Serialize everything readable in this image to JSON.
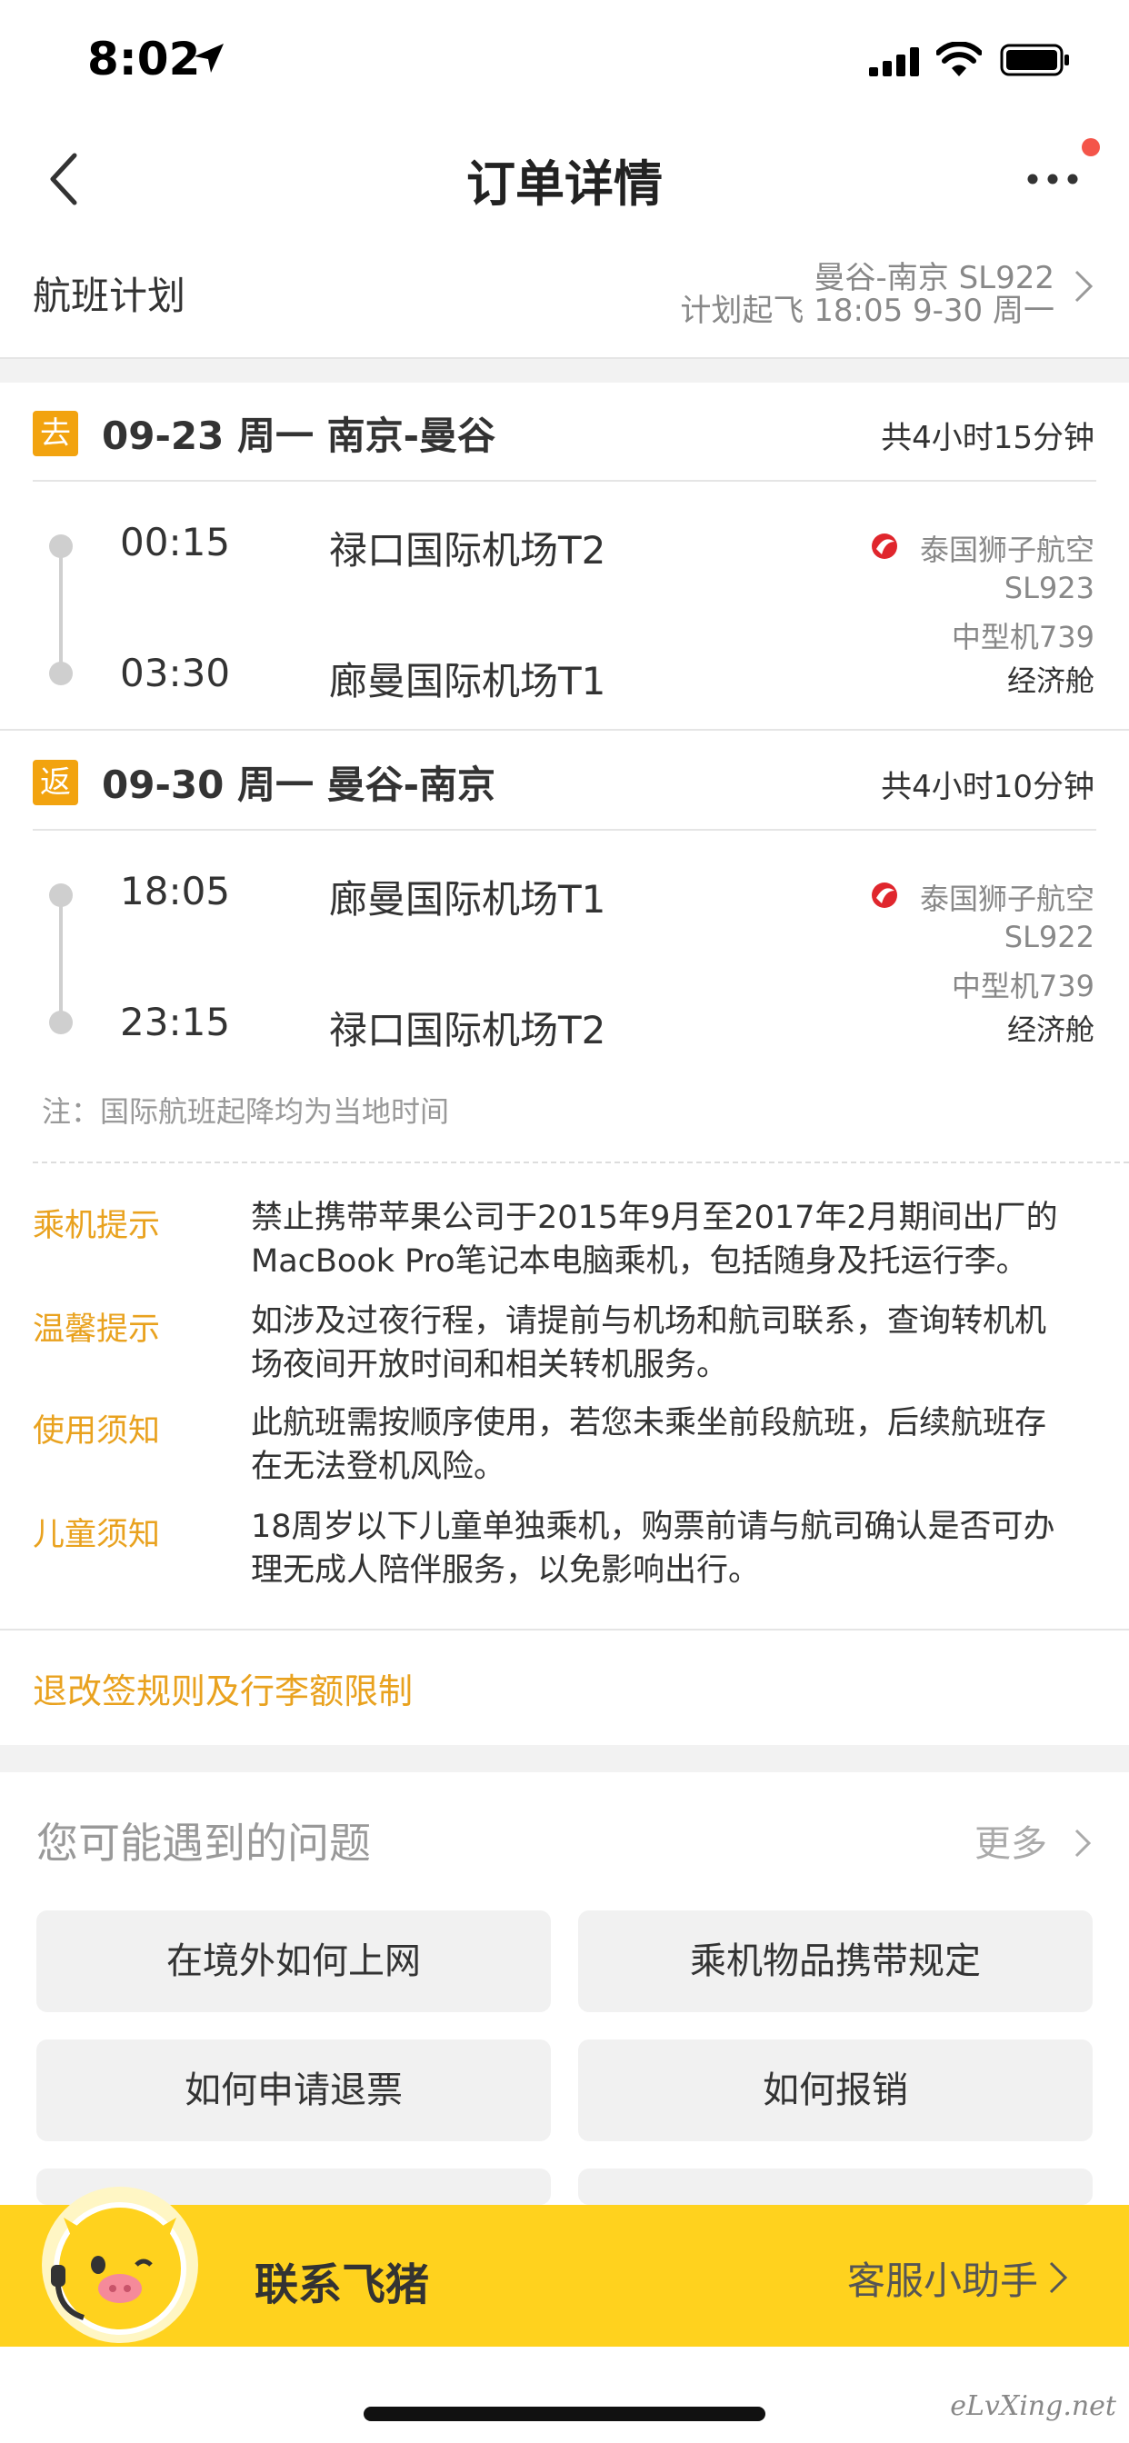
{
  "status_bar": {
    "time": "8:02"
  },
  "nav": {
    "title": "订单详情"
  },
  "flight_plan": {
    "label": "航班计划",
    "route": "曼谷-南京 SL922",
    "departure": "计划起飞 18:05 9-30 周一"
  },
  "legs": [
    {
      "badge": "去",
      "title": "09-23 周一 南京-曼谷",
      "duration": "共4小时15分钟",
      "dep_time": "00:15",
      "dep_airport": "禄口国际机场T2",
      "arr_time": "03:30",
      "arr_airport": "廊曼国际机场T1",
      "airline": "泰国狮子航空",
      "flight_no": "SL923",
      "aircraft": "中型机739",
      "cabin": "经济舱"
    },
    {
      "badge": "返",
      "title": "09-30 周一 曼谷-南京",
      "duration": "共4小时10分钟",
      "dep_time": "18:05",
      "dep_airport": "廊曼国际机场T1",
      "arr_time": "23:15",
      "arr_airport": "禄口国际机场T2",
      "airline": "泰国狮子航空",
      "flight_no": "SL922",
      "aircraft": "中型机739",
      "cabin": "经济舱"
    }
  ],
  "note": "注：国际航班起降均为当地时间",
  "tips": [
    {
      "label": "乘机提示",
      "line1": "禁止携带苹果公司于2015年9月至2017年2月期间出厂的",
      "line2": "MacBook Pro笔记本电脑乘机，包括随身及托运行李。"
    },
    {
      "label": "温馨提示",
      "line1": "如涉及过夜行程，请提前与机场和航司联系，查询转机机",
      "line2": "场夜间开放时间和相关转机服务。"
    },
    {
      "label": "使用须知",
      "line1": "此航班需按顺序使用，若您未乘坐前段航班，后续航班存",
      "line2": "在无法登机风险。"
    },
    {
      "label": "儿童须知",
      "line1": "18周岁以下儿童单独乘机，购票前请与航司确认是否可办",
      "line2": "理无成人陪伴服务，以免影响出行。"
    }
  ],
  "rules_link": "退改签规则及行李额限制",
  "faq": {
    "title": "您可能遇到的问题",
    "more": "更多",
    "items": [
      "在境外如何上网",
      "乘机物品携带规定",
      "如何申请退票",
      "如何报销"
    ]
  },
  "contact": {
    "label": "联系飞猪",
    "helper": "客服小助手"
  },
  "watermark": "eLvXing.net",
  "colors": {
    "accent": "#f2a30f",
    "tip_label": "#e9a21f",
    "contact_bar": "#ffd21e",
    "airline_red": "#e0262d"
  }
}
